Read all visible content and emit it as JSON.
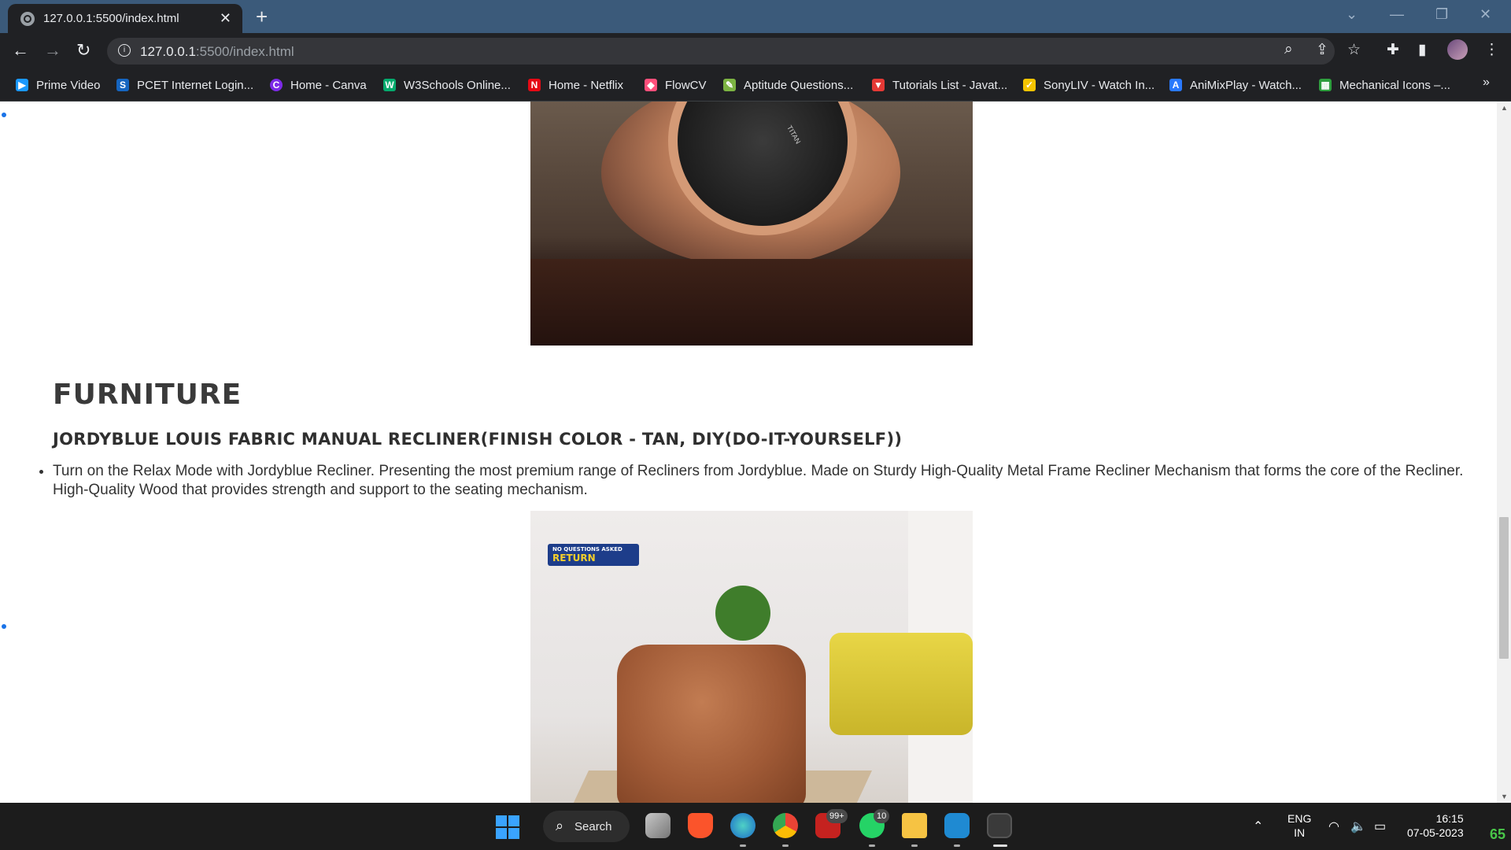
{
  "browser": {
    "tab": {
      "title": "127.0.0.1:5500/index.html",
      "close": "✕"
    },
    "new_tab": "+",
    "window_controls": {
      "tablist": "⌄",
      "minimize": "—",
      "restore": "❐",
      "close": "✕"
    },
    "nav": {
      "back": "←",
      "forward": "→",
      "reload": "↻"
    },
    "url": {
      "host": "127.0.0.1",
      "rest": ":5500/index.html"
    },
    "toolbar_icons": {
      "zoom": "⌕",
      "share": "⇪",
      "star": "☆",
      "extensions": "✚",
      "sidepanel": "▮",
      "menu": "⋮"
    },
    "bookmarks": [
      {
        "label": "Prime Video",
        "icon": "prime-video-icon",
        "color": "#1a98ff",
        "glyph": "▶"
      },
      {
        "label": "PCET Internet Login...",
        "icon": "pcet-icon",
        "color": "#1565c0",
        "glyph": "S"
      },
      {
        "label": "Home - Canva",
        "icon": "canva-icon",
        "color": "#7d2ae8",
        "glyph": "C"
      },
      {
        "label": "W3Schools Online...",
        "icon": "w3schools-icon",
        "color": "#04aa6d",
        "glyph": "W"
      },
      {
        "label": "Home - Netflix",
        "icon": "netflix-icon",
        "color": "#e50914",
        "glyph": "N"
      },
      {
        "label": "FlowCV",
        "icon": "flowcv-icon",
        "color": "#ff4f7b",
        "glyph": "◆"
      },
      {
        "label": "Aptitude Questions...",
        "icon": "indiabix-icon",
        "color": "#7cb342",
        "glyph": "✎"
      },
      {
        "label": "Tutorials List - Javat...",
        "icon": "javatpoint-icon",
        "color": "#e53935",
        "glyph": "▼"
      },
      {
        "label": "SonyLIV - Watch In...",
        "icon": "sonyliv-icon",
        "color": "#f5c400",
        "glyph": "✓"
      },
      {
        "label": "AniMixPlay - Watch...",
        "icon": "animixplay-icon",
        "color": "#2979ff",
        "glyph": "A"
      },
      {
        "label": "Mechanical Icons –...",
        "icon": "mechanical-icons-icon",
        "color": "#2e9e3e",
        "glyph": "▦"
      }
    ],
    "bookmarks_more": "»"
  },
  "page": {
    "category": "FURNITURE",
    "product_title": "JORDYBLUE LOUIS FABRIC MANUAL RECLINER(FINISH COLOR - TAN, DIY(DO-IT-YOURSELF))",
    "description": "Turn on the Relax Mode with Jordyblue Recliner. Presenting the most premium range of Recliners from Jordyblue. Made on Sturdy High-Quality Metal Frame Recliner Mechanism that forms the core of the Recliner. High-Quality Wood that provides strength and support to the seating mechanism.",
    "watch_brand": "TITAN",
    "chair_badge": {
      "top": "NO QUESTIONS ASKED",
      "main": "RETURN"
    }
  },
  "scrollbar": {
    "up": "▲",
    "down": "▼"
  },
  "taskbar": {
    "search_label": "Search",
    "badges": {
      "mail": "99+",
      "whatsapp": "10"
    },
    "tray": {
      "chevron": "⌃",
      "wifi": "◠",
      "volume": "🔈",
      "battery": "▭"
    },
    "lang_1": "ENG",
    "lang_2": "IN",
    "time": "16:15",
    "date": "07-05-2023",
    "temperature": "65"
  },
  "colors": {
    "tab_strip": "#3b5a7a",
    "chrome_dark": "#202124",
    "taskbar": "#1c1c1c",
    "heading": "#3a3a3a",
    "link_dot": "#1a73e8"
  }
}
